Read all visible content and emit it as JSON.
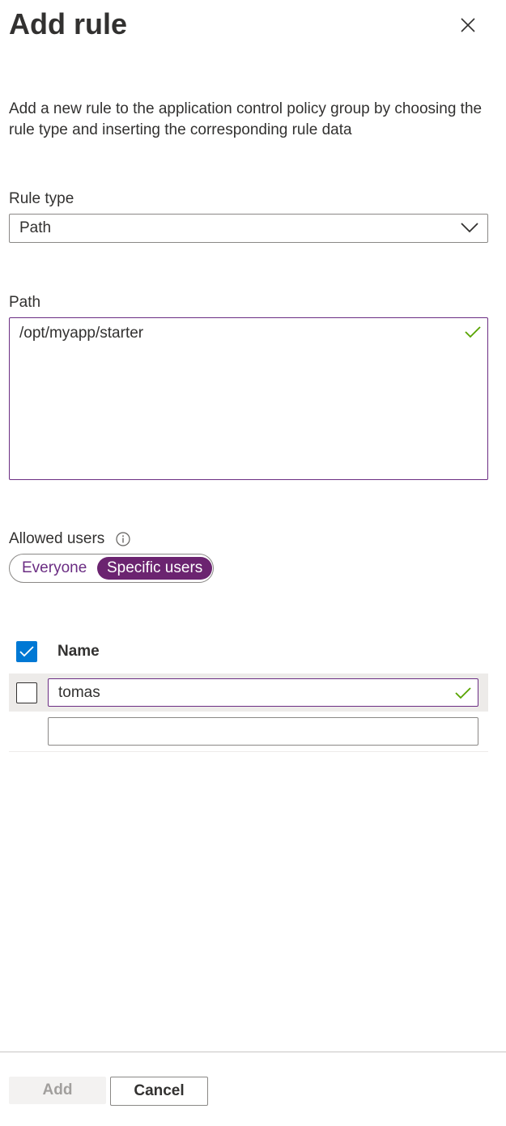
{
  "panel": {
    "title": "Add rule",
    "close_icon": "close-icon",
    "description": "Add a new rule to the application control policy group by choosing the rule type and inserting the corresponding rule data"
  },
  "rule_type": {
    "label": "Rule type",
    "value": "Path",
    "icon": "chevron-down-icon"
  },
  "path": {
    "label": "Path",
    "value": "/opt/myapp/starter",
    "status_icon": "checkmark-icon"
  },
  "allowed_users": {
    "label": "Allowed users",
    "info_icon": "info-icon",
    "options": [
      "Everyone",
      "Specific users"
    ],
    "selected": "Specific users"
  },
  "users_table": {
    "header": "Name",
    "select_all_checked": true,
    "rows": [
      {
        "value": "tomas",
        "checked": false,
        "valid": true
      },
      {
        "value": "",
        "checked": false,
        "valid": false
      }
    ]
  },
  "footer": {
    "add_label": "Add",
    "add_disabled": true,
    "cancel_label": "Cancel"
  },
  "colors": {
    "accent": "#6b2470",
    "checkbox_blue": "#0078d4",
    "valid_green": "#57a300",
    "text": "#323130"
  }
}
